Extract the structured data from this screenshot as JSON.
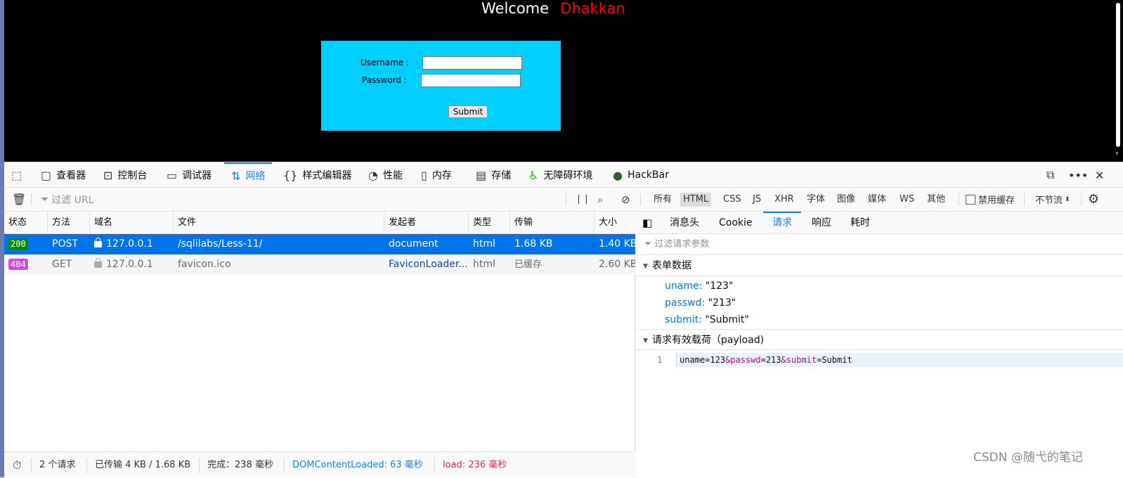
{
  "web": {
    "welcome": "Welcome",
    "welcome_name": "Dhakkan",
    "username_label": "Username :",
    "password_label": "Password :",
    "submit_label": "Submit",
    "colors": {
      "background": "#000000",
      "box": "#00cfff",
      "name": "#ff0000"
    }
  },
  "devtools": {
    "tabs": [
      {
        "label": "查看器",
        "icon": "inspector-icon"
      },
      {
        "label": "控制台",
        "icon": "console-icon"
      },
      {
        "label": "调试器",
        "icon": "debugger-icon"
      },
      {
        "label": "网络",
        "icon": "network-icon"
      },
      {
        "label": "样式编辑器",
        "icon": "style-editor-icon"
      },
      {
        "label": "性能",
        "icon": "performance-icon"
      },
      {
        "label": "内存",
        "icon": "memory-icon"
      },
      {
        "label": "存储",
        "icon": "storage-icon"
      },
      {
        "label": "无障碍环境",
        "icon": "accessibility-icon"
      },
      {
        "label": "HackBar",
        "icon": "hackbar-icon"
      }
    ],
    "active_tab": "网络",
    "toolbar": {
      "filter_placeholder": "过滤 URL",
      "types": [
        "所有",
        "HTML",
        "CSS",
        "JS",
        "XHR",
        "字体",
        "图像",
        "媒体",
        "WS",
        "其他"
      ],
      "selected_type": "HTML",
      "disable_cache": "禁用缓存",
      "throttle": "不节流"
    },
    "table": {
      "columns": [
        "状态",
        "方法",
        "域名",
        "文件",
        "发起者",
        "类型",
        "传输",
        "大小"
      ],
      "rows": [
        {
          "status": "200",
          "method": "POST",
          "domain": "127.0.0.1",
          "file": "/sqlilabs/Less-11/",
          "initiator": "document",
          "type": "html",
          "transfer": "1.68 KB",
          "size": "1.40 KB"
        },
        {
          "status": "404",
          "method": "GET",
          "domain": "127.0.0.1",
          "file": "favicon.ico",
          "initiator": "FaviconLoader...",
          "type": "html",
          "transfer": "已缓存",
          "size": "2.60 KB"
        }
      ]
    },
    "statusbar": {
      "requests": "2 个请求",
      "transferred": "已传输 4 KB / 1.68 KB",
      "finish": "完成：238 毫秒",
      "dom_loaded": "DOMContentLoaded: 63 毫秒",
      "load": "load: 236 毫秒"
    },
    "detail": {
      "tabs": [
        "消息头",
        "Cookie",
        "请求",
        "响应",
        "耗时"
      ],
      "active_tab": "请求",
      "filter_placeholder": "过滤请求参数",
      "form_section": "表单数据",
      "form": [
        {
          "key": "uname:",
          "value": "\"123\""
        },
        {
          "key": "passwd:",
          "value": "\"213\""
        },
        {
          "key": "submit:",
          "value": "\"Submit\""
        }
      ],
      "payload_section": "请求有效载荷（payload)",
      "payload_line_no": "1",
      "payload": {
        "p1": "uname=123",
        "p2": "&passwd",
        "p3": "=213",
        "p4": "&submit",
        "p5": "=Submit"
      }
    }
  },
  "watermark": "CSDN @随弋的笔记"
}
